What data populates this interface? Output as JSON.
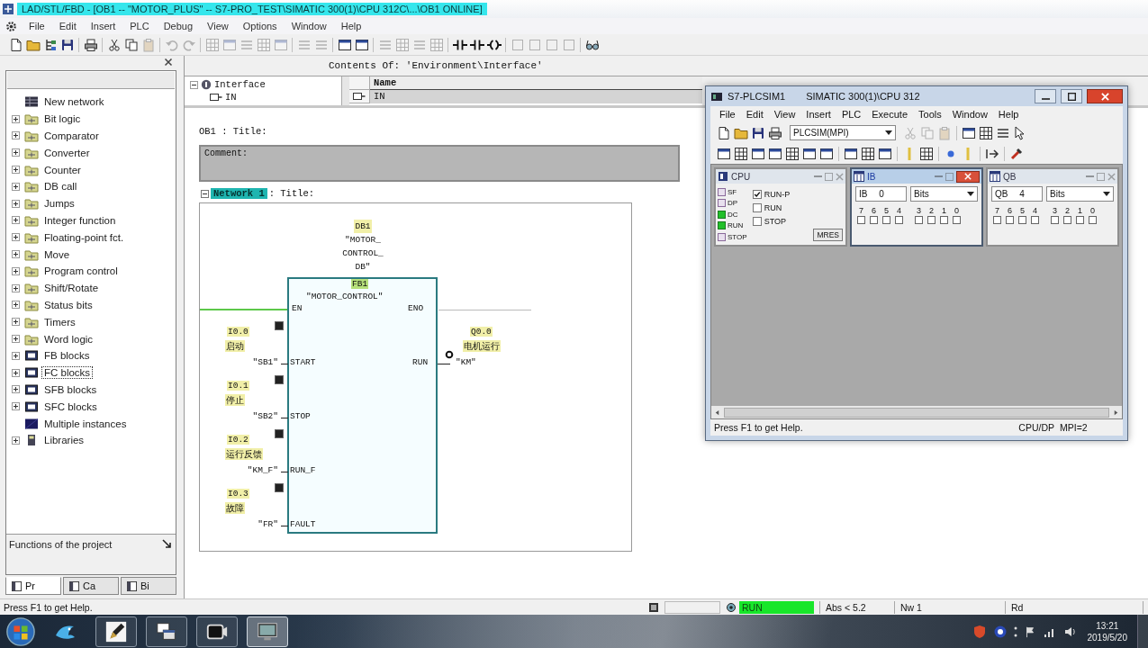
{
  "window": {
    "title": "LAD/STL/FBD - [OB1 -- \"MOTOR_PLUS\" -- S7-PRO_TEST\\SIMATIC 300(1)\\CPU 312C\\...\\OB1 ONLINE]"
  },
  "menu": [
    "File",
    "Edit",
    "Insert",
    "PLC",
    "Debug",
    "View",
    "Options",
    "Window",
    "Help"
  ],
  "program_elements": {
    "items": [
      {
        "label": "New network",
        "kind": "network",
        "selected": false
      },
      {
        "label": "Bit logic",
        "kind": "folder",
        "expanded": false,
        "selected": false
      },
      {
        "label": "Comparator",
        "kind": "folder",
        "expanded": false,
        "selected": false
      },
      {
        "label": "Converter",
        "kind": "folder",
        "expanded": false,
        "selected": false
      },
      {
        "label": "Counter",
        "kind": "folder",
        "expanded": false,
        "selected": false
      },
      {
        "label": "DB call",
        "kind": "folder",
        "expanded": false,
        "selected": false
      },
      {
        "label": "Jumps",
        "kind": "folder",
        "expanded": false,
        "selected": false
      },
      {
        "label": "Integer function",
        "kind": "folder",
        "expanded": false,
        "selected": false
      },
      {
        "label": "Floating-point fct.",
        "kind": "folder",
        "expanded": false,
        "selected": false
      },
      {
        "label": "Move",
        "kind": "folder",
        "expanded": false,
        "selected": false
      },
      {
        "label": "Program control",
        "kind": "folder",
        "expanded": false,
        "selected": false
      },
      {
        "label": "Shift/Rotate",
        "kind": "folder",
        "expanded": false,
        "selected": false
      },
      {
        "label": "Status bits",
        "kind": "folder",
        "expanded": false,
        "selected": false
      },
      {
        "label": "Timers",
        "kind": "folder",
        "expanded": false,
        "selected": false
      },
      {
        "label": "Word logic",
        "kind": "folder",
        "expanded": false,
        "selected": false
      },
      {
        "label": "FB blocks",
        "kind": "block",
        "expanded": false,
        "selected": false
      },
      {
        "label": "FC blocks",
        "kind": "block",
        "expanded": false,
        "selected": true
      },
      {
        "label": "SFB blocks",
        "kind": "block",
        "expanded": false,
        "selected": false
      },
      {
        "label": "SFC blocks",
        "kind": "block",
        "expanded": false,
        "selected": false
      },
      {
        "label": "Multiple instances",
        "kind": "instances",
        "selected": false
      },
      {
        "label": "Libraries",
        "kind": "library",
        "expanded": false,
        "selected": false
      }
    ],
    "footer": "Functions of the project",
    "tabs": [
      {
        "label": "Pr",
        "selected": true
      },
      {
        "label": "Ca",
        "selected": false
      },
      {
        "label": "Bi",
        "selected": false
      }
    ]
  },
  "editor": {
    "contents_header": "Contents Of: 'Environment\\Interface'",
    "interface_tree": [
      {
        "label": "Interface",
        "expanded": true,
        "children": [
          {
            "label": "IN"
          }
        ]
      }
    ],
    "interface_table": {
      "columns": [
        "Name"
      ],
      "rows": [
        {
          "name": "IN",
          "selected": true
        }
      ]
    },
    "block_title": "OB1 : Title:",
    "comment_label": "Comment:",
    "networks": [
      {
        "label": "Network 1",
        "title": ": Title:",
        "selected": true,
        "diagram": {
          "instance_db": {
            "address": "DB1",
            "name": "\"MOTOR_CONTROL_DB\""
          },
          "block_number": "FB1",
          "block_name": "\"MOTOR_CONTROL\"",
          "en": {
            "pin": "EN",
            "powered": true
          },
          "eno": {
            "pin": "ENO",
            "powered": false
          },
          "inputs": [
            {
              "pin": "START",
              "address": "I0.0",
              "comment": "启动",
              "operand": "\"SB1\""
            },
            {
              "pin": "STOP",
              "address": "I0.1",
              "comment": "停止",
              "operand": "\"SB2\""
            },
            {
              "pin": "RUN_F",
              "address": "I0.2",
              "comment": "运行反馈",
              "operand": "\"KM_F\""
            },
            {
              "pin": "FAULT",
              "address": "I0.3",
              "comment": "故障",
              "operand": "\"FR\""
            }
          ],
          "outputs": [
            {
              "pin": "RUN",
              "address": "Q0.0",
              "comment": "电机运行",
              "operand": "\"KM\""
            }
          ]
        }
      }
    ]
  },
  "plcsim": {
    "title": "S7-PLCSIM1",
    "subtitle": "SIMATIC 300(1)\\CPU 312",
    "menu": [
      "File",
      "Edit",
      "View",
      "Insert",
      "PLC",
      "Execute",
      "Tools",
      "Window",
      "Help"
    ],
    "access_dropdown": "PLCSIM(MPI)",
    "cpu": {
      "title": "CPU",
      "lamps": [
        {
          "label": "SF",
          "on": false
        },
        {
          "label": "DP",
          "on": false
        },
        {
          "label": "DC",
          "on": true
        },
        {
          "label": "RUN",
          "on": true
        },
        {
          "label": "STOP",
          "on": false
        }
      ],
      "modes": [
        {
          "label": "RUN-P",
          "selected": true
        },
        {
          "label": "RUN",
          "selected": false
        },
        {
          "label": "STOP",
          "selected": false
        }
      ],
      "reset_button": "MRES"
    },
    "byte_windows": [
      {
        "title": "IB",
        "active": true,
        "address": "IB 0",
        "format": "Bits",
        "bits": [
          {
            "label": "7",
            "checked": false
          },
          {
            "label": "6",
            "checked": false
          },
          {
            "label": "5",
            "checked": false
          },
          {
            "label": "4",
            "checked": false
          },
          {
            "label": "3",
            "checked": false
          },
          {
            "label": "2",
            "checked": false
          },
          {
            "label": "1",
            "checked": false
          },
          {
            "label": "0",
            "checked": false
          }
        ]
      },
      {
        "title": "QB",
        "active": false,
        "address": "QB 4",
        "format": "Bits",
        "bits": [
          {
            "label": "7",
            "checked": false
          },
          {
            "label": "6",
            "checked": false
          },
          {
            "label": "5",
            "checked": false
          },
          {
            "label": "4",
            "checked": false
          },
          {
            "label": "3",
            "checked": false
          },
          {
            "label": "2",
            "checked": false
          },
          {
            "label": "1",
            "checked": false
          },
          {
            "label": "0",
            "checked": false
          }
        ]
      }
    ],
    "status": {
      "help": "Press F1 to get Help.",
      "connection": "CPU/DP",
      "mpi": "MPI=2"
    }
  },
  "status_bar": {
    "help": "Press F1 to get Help.",
    "cpu_mode": "RUN",
    "online": true,
    "position": "Abs < 5.2",
    "network": "Nw 1",
    "mode": "Rd"
  },
  "taskbar": {
    "time": "13:21",
    "date": "2019/5/20"
  }
}
